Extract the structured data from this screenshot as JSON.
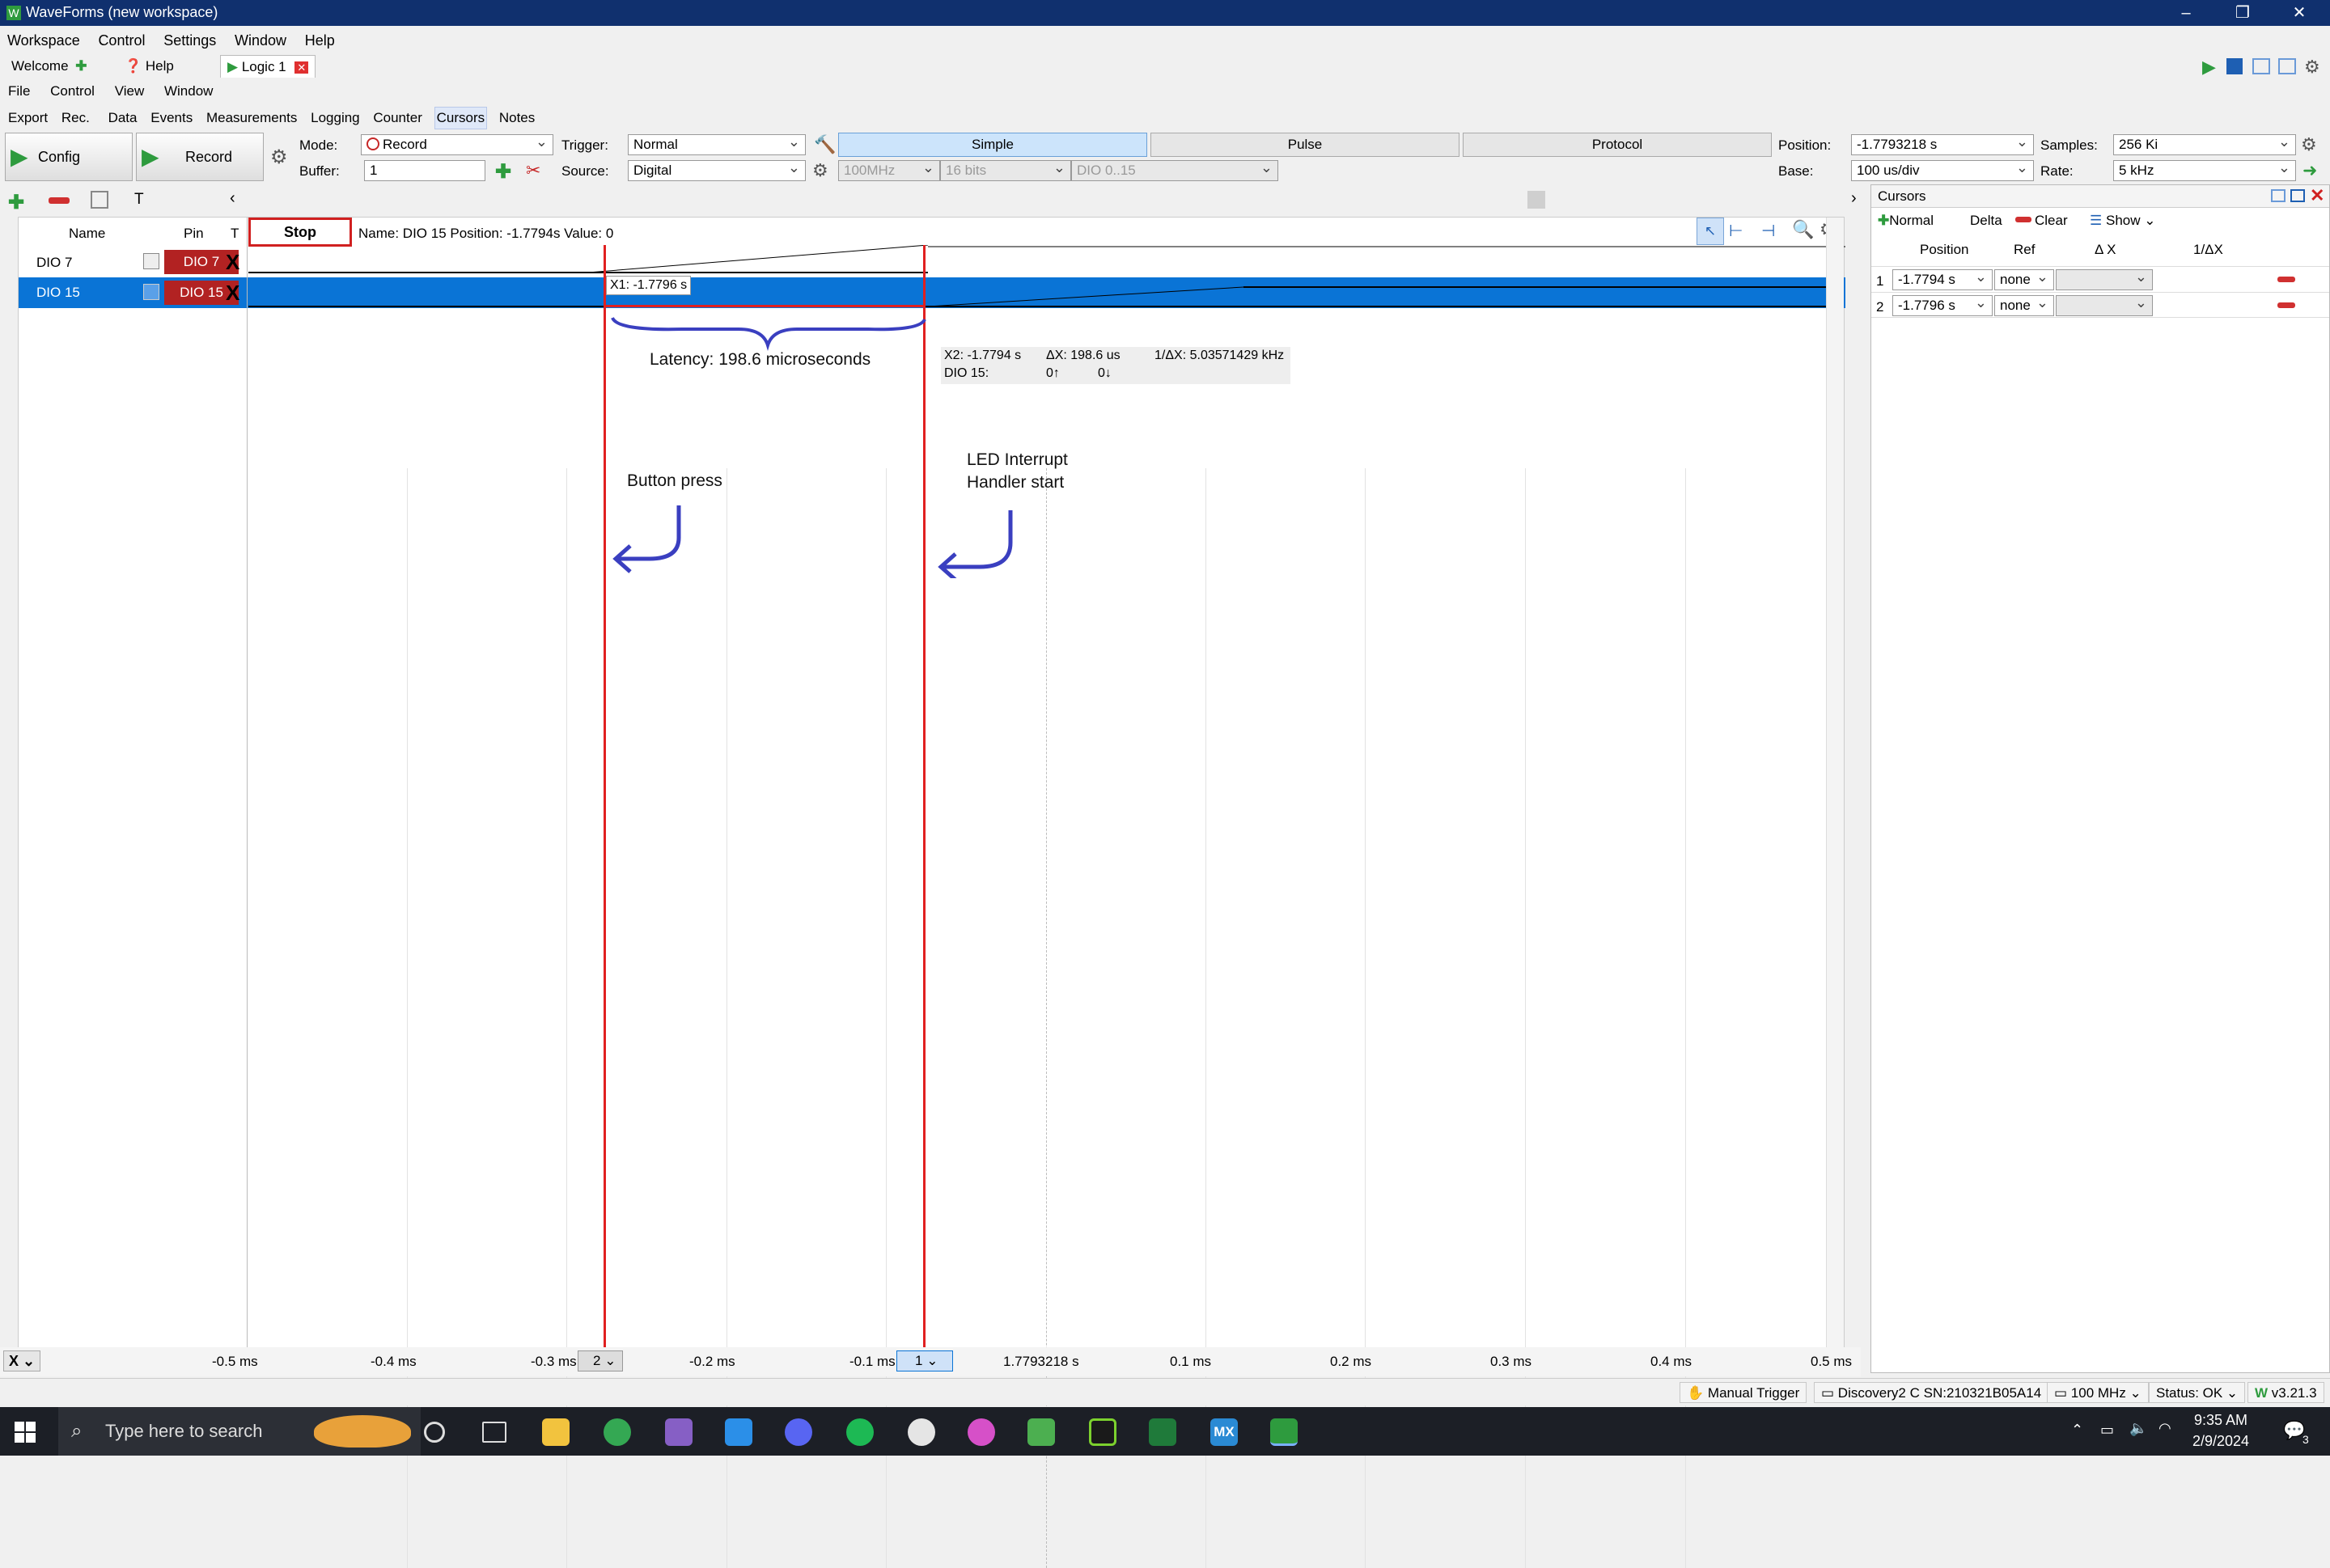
{
  "window": {
    "title": "WaveForms (new workspace)"
  },
  "menu_main": [
    "Workspace",
    "Control",
    "Settings",
    "Window",
    "Help"
  ],
  "tabs": {
    "welcome": "Welcome",
    "help": "Help",
    "logic": "Logic 1"
  },
  "menu_instrument": [
    "File",
    "Control",
    "View",
    "Window"
  ],
  "menu_sub": [
    "Export",
    "Rec.",
    "Data",
    "Events",
    "Measurements",
    "Logging",
    "Counter",
    "Cursors",
    "Notes"
  ],
  "toolbar": {
    "config_label": "Config",
    "record_label": "Record",
    "mode_label": "Mode:",
    "mode_value": "Record",
    "buffer_label": "Buffer:",
    "buffer_value": "1",
    "trigger_label": "Trigger:",
    "trigger_value": "Normal",
    "source_label": "Source:",
    "source_value": "Digital",
    "simple_label": "Simple",
    "pulse_label": "Pulse",
    "protocol_label": "Protocol",
    "clock_value": "100MHz",
    "bits_value": "16 bits",
    "dio_range_value": "DIO 0..15",
    "position_label": "Position:",
    "position_value": "-1.7793218 s",
    "samples_label": "Samples:",
    "samples_value": "256 Ki",
    "base_label": "Base:",
    "base_value": "100 us/div",
    "rate_label": "Rate:",
    "rate_value": "5 kHz"
  },
  "channels": {
    "header_name": "Name",
    "header_pin": "Pin",
    "header_t": "T",
    "stop_label": "Stop",
    "info": "Name: DIO 15  Position: -1.7794s  Value: 0",
    "rows": [
      {
        "name": "DIO 7",
        "pin": "DIO 7",
        "t": "X"
      },
      {
        "name": "DIO 15",
        "pin": "DIO 15",
        "t": "X"
      }
    ]
  },
  "plot": {
    "x1_label": "X1: -1.7796 s",
    "x2_readout": {
      "x2": "X2: -1.7794 s",
      "dx": "ΔX: 198.6 us",
      "inv": "1/ΔX: 5.03571429 kHz",
      "dio_label": "DIO 15:",
      "rise": "0↑",
      "fall": "0↓"
    },
    "ticks": [
      "-0.5 ms",
      "-0.4 ms",
      "-0.3 ms",
      "-0.2 ms",
      "-0.1 ms",
      "1.7793218 s",
      "0.1 ms",
      "0.2 ms",
      "0.3 ms",
      "0.4 ms",
      "0.5 ms"
    ],
    "cursor_badge_2": "2",
    "cursor_badge_1": "1"
  },
  "annotations": {
    "latency": "Latency:  198.6 microseconds",
    "button_press": "Button press",
    "led_line1": "LED Interrupt",
    "led_line2": "Handler start"
  },
  "cursors_panel": {
    "title": "Cursors",
    "normal": "Normal",
    "delta": "Delta",
    "clear": "Clear",
    "show": "Show",
    "headers": [
      "Position",
      "Ref",
      "Δ X",
      "1/ΔX"
    ],
    "rows": [
      {
        "idx": "1",
        "position": "-1.7794 s",
        "ref": "none"
      },
      {
        "idx": "2",
        "position": "-1.7796 s",
        "ref": "none"
      }
    ]
  },
  "statusbar": {
    "manual_trigger": "Manual Trigger",
    "device": "Discovery2 C SN:210321B05A14",
    "clock": "100 MHz",
    "status": "Status: OK",
    "version": "v3.21.3"
  },
  "taskbar": {
    "search_placeholder": "Type here to search",
    "time": "9:35 AM",
    "date": "2/9/2024",
    "notif": "3"
  },
  "colors": {
    "titlebar": "#10306e",
    "selected_row": "#0a74d6",
    "cursor_line": "#e02020",
    "annotation_ink": "#3a3fc0",
    "pin_badge": "#b22222"
  }
}
